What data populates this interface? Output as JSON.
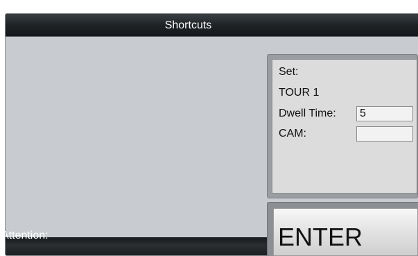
{
  "window": {
    "title": "Shortcuts"
  },
  "info_panel": {
    "set_label": "Set:",
    "tour_name": "TOUR 1",
    "dwell_label": "Dwell Time:",
    "dwell_value": "5",
    "cam_label": "CAM:",
    "cam_value": ""
  },
  "enter_button": {
    "label": "ENTER"
  },
  "status_bar": {
    "attention_label": "Attention:"
  }
}
